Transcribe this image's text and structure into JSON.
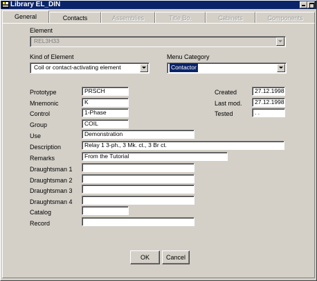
{
  "window": {
    "title": "Library EL_DIN",
    "title_color": "#0a246a"
  },
  "tabs": [
    {
      "label": "General",
      "state": "active"
    },
    {
      "label": "Contacts",
      "state": "enabled"
    },
    {
      "label": "Assemblies",
      "state": "disabled"
    },
    {
      "label": "Title Bo.",
      "state": "disabled"
    },
    {
      "label": "Cabinets",
      "state": "disabled"
    },
    {
      "label": "Components",
      "state": "disabled"
    }
  ],
  "element": {
    "label": "Element",
    "value": "REL3H33"
  },
  "kind_of_element": {
    "label": "Kind of Element",
    "value": "Coil or contact-activating element"
  },
  "menu_category": {
    "label": "Menu Category",
    "value": "Contactor"
  },
  "fields": {
    "prototype": {
      "label": "Prototype",
      "value": "PRSCH"
    },
    "mnemonic": {
      "label": "Mnemonic",
      "value": "K"
    },
    "control": {
      "label": "Control",
      "value": "1-Phase"
    },
    "group": {
      "label": "Group",
      "value": "COIL"
    },
    "use": {
      "label": "Use",
      "value": "Demonstration"
    },
    "description": {
      "label": "Description",
      "value": "Relay 1 3-ph., 3 Mk. ct., 3 Br ct."
    },
    "remarks": {
      "label": "Remarks",
      "value": "From the Tutorial"
    },
    "draughtsman1": {
      "label": "Draughtsman 1",
      "value": ""
    },
    "draughtsman2": {
      "label": "Draughtsman 2",
      "value": ""
    },
    "draughtsman3": {
      "label": "Draughtsman 3",
      "value": ""
    },
    "draughtsman4": {
      "label": "Draughtsman 4",
      "value": ""
    },
    "catalog": {
      "label": "Catalog",
      "value": ""
    },
    "record": {
      "label": "Record",
      "value": ""
    }
  },
  "dates": {
    "created": {
      "label": "Created",
      "value": "27.12.1998"
    },
    "last_mod": {
      "label": "Last mod.",
      "value": "27.12.1998"
    },
    "tested": {
      "label": "Tested",
      "value": ". ."
    }
  },
  "buttons": {
    "ok": "OK",
    "cancel": "Cancel"
  },
  "icons": {
    "app": "app-icon",
    "minimize": "minimize-icon",
    "maximize": "maximize-icon"
  }
}
